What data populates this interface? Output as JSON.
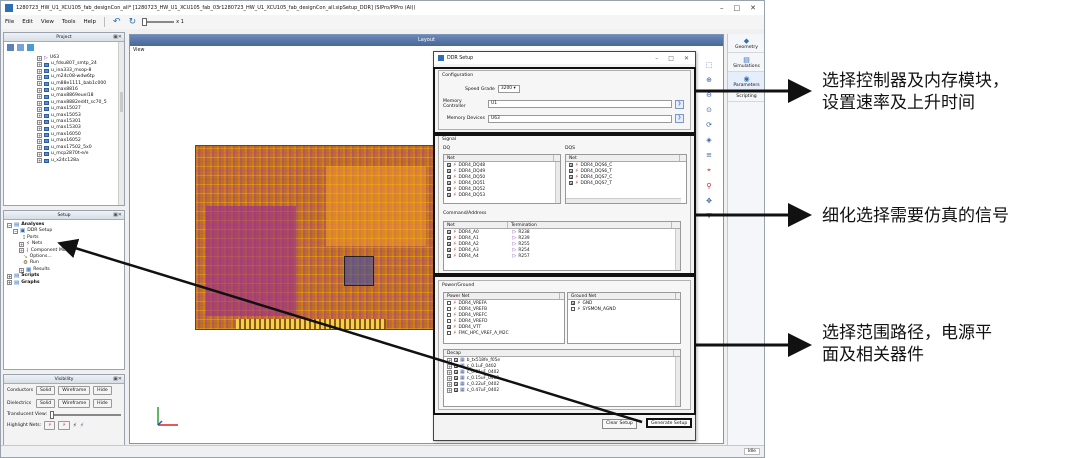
{
  "app": {
    "title": "1280723_HW_U1_XCU105_fab_designCon_all* [1280723_HW_U1_XCU105_fab_03r1280723_HW_U1_XCU105_fab_designCon_all.sipSetup_DDR] (SIPro/PIPro (AI))",
    "menu": [
      "File",
      "Edit",
      "View",
      "Tools",
      "Help"
    ],
    "zoom_label": "x 1"
  },
  "project_panel": {
    "title": "Project",
    "items": [
      "U63",
      "u_fdsu807_smtp_24",
      "u_ina333_msop-8",
      "u_m24c08-wdw6tp",
      "u_m88e1111_bab1c000",
      "u_max8816",
      "u_max8869euel18",
      "u_max8882ed4t_sc70_5",
      "u_max15027",
      "u_max15053",
      "u_max15301",
      "u_max15303",
      "u_max16050",
      "u_max16052",
      "u_max17502_5x0",
      "u_mcp2870t-e/e",
      "u_x24c128a"
    ]
  },
  "setup_panel": {
    "title": "Setup",
    "tree": {
      "analyses": "Analyses",
      "ddr_setup": "DDR Setup",
      "ports": "Ports",
      "nets": "Nets",
      "component_models": "Component Models",
      "options": "Options...",
      "run": "Run",
      "results": "Results",
      "scripts": "Scripts",
      "graphs": "Graphs"
    }
  },
  "visibility_panel": {
    "title": "Visibility",
    "conductors": "Conductors",
    "dielectrics": "Dielectrics",
    "solid": "Solid",
    "wireframe": "Wireframe",
    "hide": "Hide",
    "translucent": "Translucent View:",
    "highlight": "Highlight Nets:"
  },
  "layout": {
    "title": "Layout",
    "view": "View"
  },
  "right_panel": {
    "geometry": "Geometry",
    "simulations": "Simulations",
    "parameters": "Parameters",
    "scripting": "Scripting"
  },
  "dialog": {
    "title": "DDR Setup",
    "configuration": {
      "label": "Configuration",
      "speed_grade_label": "Speed Grade",
      "speed_grade_value": "3200",
      "memory_controller_label": "Memory Controller",
      "memory_controller_value": "U1",
      "memory_devices_label": "Memory Devices",
      "memory_devices_value": "U63"
    },
    "signal": {
      "label": "Signal",
      "dq_label": "DQ",
      "dqs_label": "DQS",
      "net_header": "Net",
      "dq_nets": [
        "DDR4_DQ48",
        "DDR4_DQ49",
        "DDR4_DQ50",
        "DDR4_DQ51",
        "DDR4_DQ52",
        "DDR4_DQ53"
      ],
      "dqs_nets": [
        "DDR4_DQS6_C",
        "DDR4_DQS6_T",
        "DDR4_DQS7_C",
        "DDR4_DQS7_T"
      ]
    },
    "command": {
      "label": "Command/Address",
      "net_header": "Net",
      "term_header": "Termination",
      "rows": [
        {
          "net": "DDR4_A0",
          "term": "R238"
        },
        {
          "net": "DDR4_A1",
          "term": "R239"
        },
        {
          "net": "DDR4_A2",
          "term": "R255"
        },
        {
          "net": "DDR4_A3",
          "term": "R254"
        },
        {
          "net": "DDR4_A4",
          "term": "R257"
        }
      ]
    },
    "power": {
      "label": "Power/Ground",
      "power_header": "Power Net",
      "ground_header": "Ground Net",
      "power_nets": [
        "DDR4_VREFA",
        "DDR4_VREFB",
        "DDR4_VREFC",
        "DDR4_VREFD",
        "DDR4_VTT",
        "FMC_HPC_VREF_A_M2C"
      ],
      "ground_nets": [
        "GND",
        "SYSMON_AGND"
      ]
    },
    "decap": {
      "label": "Decap",
      "items": [
        "b_tx518fe_f05e",
        "c_0.1uF_0402",
        "c_0.01uF_0402",
        "c_0.15uF_0402",
        "c_0.22uF_0402",
        "c_0.47uF_0402"
      ]
    },
    "clear_label": "Clear Setup",
    "generate_label": "Generate Setup"
  },
  "status": {
    "idle": "Idle"
  },
  "annotations": {
    "a1_line1": "选择控制器及内存模块，",
    "a1_line2": "设置速率及上升时间",
    "a2": "细化选择需要仿真的信号",
    "a3_line1": "选择范围路径，电源平",
    "a3_line2": "面及相关器件"
  }
}
